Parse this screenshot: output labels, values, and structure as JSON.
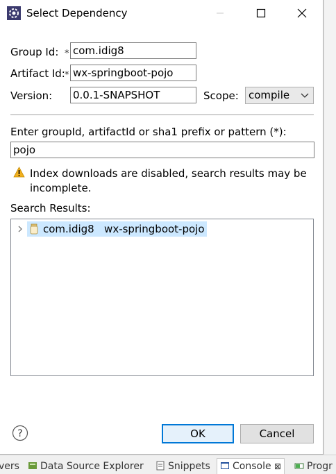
{
  "dialog": {
    "title": "Select Dependency"
  },
  "form": {
    "group_id_label": "Group Id:",
    "group_id_value": "com.idig8",
    "artifact_id_label": "Artifact Id:",
    "artifact_id_value": "wx-springboot-pojo",
    "version_label": "Version:",
    "version_value": "0.0.1-SNAPSHOT",
    "scope_label": "Scope:",
    "scope_value": "compile",
    "required_marker": "*"
  },
  "search": {
    "prompt": "Enter groupId, artifactId or sha1 prefix or pattern (*):",
    "value": "pojo",
    "warning": "Index downloads are disabled, search results may be incomplete.",
    "results_label": "Search Results:"
  },
  "results": [
    {
      "group": "com.idig8",
      "artifact": "wx-springboot-pojo"
    }
  ],
  "buttons": {
    "ok": "OK",
    "cancel": "Cancel"
  },
  "background": {
    "tabs": [
      "vers",
      "Data Source Explorer",
      "Snippets",
      "Console",
      "Progr"
    ]
  },
  "colors": {
    "accent": "#0078d7",
    "selection": "#cce8ff",
    "warning": "#e8a317"
  }
}
